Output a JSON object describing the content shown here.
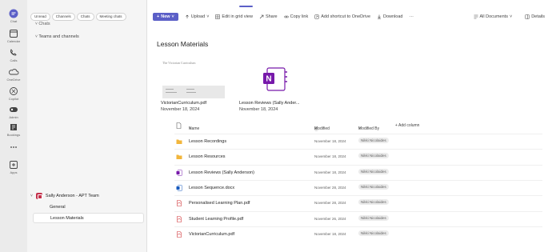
{
  "rail": {
    "items": [
      {
        "label": "Chat",
        "icon": "chat-icon"
      },
      {
        "label": "Calendar",
        "icon": "calendar-icon"
      },
      {
        "label": "Calls",
        "icon": "calls-icon"
      },
      {
        "label": "OneDrive",
        "icon": "onedrive-icon"
      },
      {
        "label": "Copilot",
        "icon": "copilot-icon"
      },
      {
        "label": "Admin",
        "icon": "admin-icon"
      },
      {
        "label": "Bookings",
        "icon": "bookings-icon"
      },
      {
        "label": "",
        "icon": "more-icon"
      },
      {
        "label": "Apps",
        "icon": "apps-icon"
      }
    ]
  },
  "chatpane": {
    "filters": [
      "Unread",
      "Channels",
      "Chats",
      "Meeting chats"
    ],
    "chats_header": "Chats",
    "teams_header": "Teams and channels",
    "team_name": "Sally Anderson - APT Team",
    "channels": [
      "General",
      "Lesson Materials"
    ]
  },
  "toolbar": {
    "new_label": "New",
    "upload_label": "Upload",
    "grid_label": "Edit in grid view",
    "share_label": "Share",
    "copy_label": "Copy link",
    "shortcut_label": "Add shortcut to OneDrive",
    "download_label": "Download",
    "more_label": "···",
    "view_label": "All Documents",
    "details_label": "Details"
  },
  "library": {
    "title": "Lesson Materials",
    "thumb_text": "The Victorian Curriculum",
    "cards": [
      {
        "name": "VictorianCurriculum.pdf",
        "date": "November 18, 2024"
      },
      {
        "name": "Lesson Reviews (Sally Ander...",
        "date": "November 18, 2024"
      }
    ]
  },
  "table": {
    "headers": {
      "name": "Name",
      "modified": "Modified",
      "modified_by": "Modified By",
      "add_column": "+ Add column"
    },
    "rows": [
      {
        "name": "Lesson Recordings",
        "modified": "November 18, 2024",
        "by": "Nikki Nicolaides",
        "type": "folder"
      },
      {
        "name": "Lesson Resources",
        "modified": "November 18, 2024",
        "by": "Nikki Nicolaides",
        "type": "folder"
      },
      {
        "name": "Lesson Reviews (Sally Anderson)",
        "modified": "November 18, 2024",
        "by": "Nikki Nicolaides",
        "type": "onenote"
      },
      {
        "name": "Lesson Sequence.docx",
        "modified": "November 28, 2024",
        "by": "Nikki Nicolaides",
        "type": "word"
      },
      {
        "name": "Personalised Learning Plan.pdf",
        "modified": "November 28, 2024",
        "by": "Nikki Nicolaides",
        "type": "pdf"
      },
      {
        "name": "Student Learning Profile.pdf",
        "modified": "November 26, 2024",
        "by": "Nikki Nicolaides",
        "type": "pdf"
      },
      {
        "name": "VictorianCurriculum.pdf",
        "modified": "November 18, 2024",
        "by": "Nikki Nicolaides",
        "type": "pdf"
      }
    ]
  },
  "colors": {
    "brand": "#5b5fc7",
    "folder": "#f2b63c",
    "pdf": "#d13438",
    "onenote": "#7719aa",
    "word": "#185abd"
  }
}
